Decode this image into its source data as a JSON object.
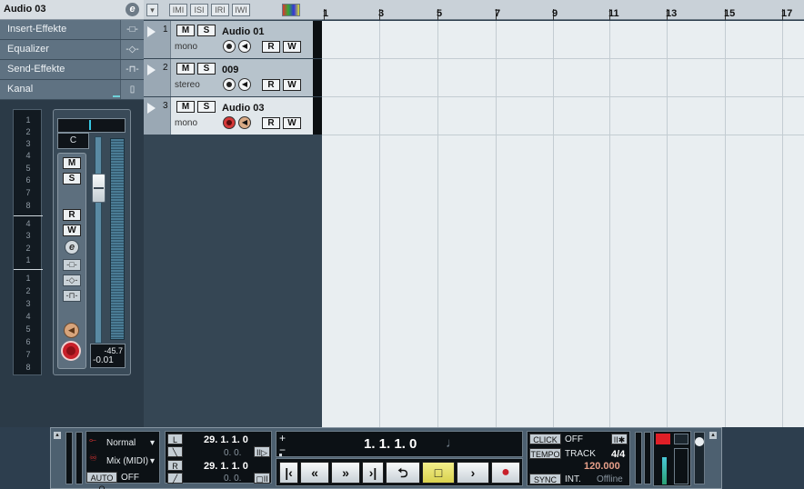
{
  "inspector": {
    "track_name": "Audio 03",
    "edit_icon": "e",
    "sections": [
      {
        "label": "Insert-Effekte",
        "icon": "insert-icon"
      },
      {
        "label": "Equalizer",
        "icon": "eq-icon"
      },
      {
        "label": "Send-Effekte",
        "icon": "send-icon"
      },
      {
        "label": "Kanal",
        "icon": "channel-icon"
      }
    ],
    "scale_top": [
      "1",
      "2",
      "3",
      "4",
      "5",
      "6",
      "7",
      "8"
    ],
    "scale_mid": [
      "4",
      "3",
      "2",
      "1"
    ],
    "scale_bot": [
      "1",
      "2",
      "3",
      "4",
      "5",
      "6",
      "7",
      "8"
    ],
    "pan_value": "C",
    "buttons": {
      "mute": "M",
      "solo": "S",
      "read": "R",
      "write": "W",
      "edit": "e"
    },
    "meter_peak": "-45.7",
    "fader_value": "-0.01"
  },
  "toolbar": {
    "tools": [
      "IMI",
      "ISI",
      "IRI",
      "IWI"
    ]
  },
  "tracks": [
    {
      "num": "1",
      "name": "Audio 01",
      "mode": "mono",
      "m": "M",
      "s": "S",
      "r": "R",
      "w": "W",
      "selected": false
    },
    {
      "num": "2",
      "name": "009",
      "mode": "stereo",
      "m": "M",
      "s": "S",
      "r": "R",
      "w": "W",
      "selected": false
    },
    {
      "num": "3",
      "name": "Audio 03",
      "mode": "mono",
      "m": "M",
      "s": "S",
      "r": "R",
      "w": "W",
      "selected": true
    }
  ],
  "ruler": {
    "labels": [
      "1",
      "3",
      "5",
      "7",
      "9",
      "11",
      "13",
      "15",
      "17"
    ]
  },
  "transport": {
    "mode1": "Normal",
    "mode2": "Mix (MIDI)",
    "autoq_label": "AUTO Q",
    "autoq_value": "OFF",
    "left_locator": "29.  1.  1.    0",
    "left_sub": "0.    0.",
    "right_locator": "29.  1.  1.    0",
    "right_sub": "0.    0.",
    "position": "1.  1.  1.     0",
    "click_label": "CLICK",
    "click_value": "OFF",
    "tempo_label": "TEMPO",
    "tempo_mode": "TRACK",
    "signature": "4/4",
    "tempo": "120.000",
    "sync_label": "SYNC",
    "sync_source": "INT.",
    "sync_state": "Offline",
    "plus": "+",
    "minus": "−"
  },
  "colors": {
    "record": "#c8202a",
    "tempo": "#e8a08a",
    "accent": "#37c7e3"
  }
}
